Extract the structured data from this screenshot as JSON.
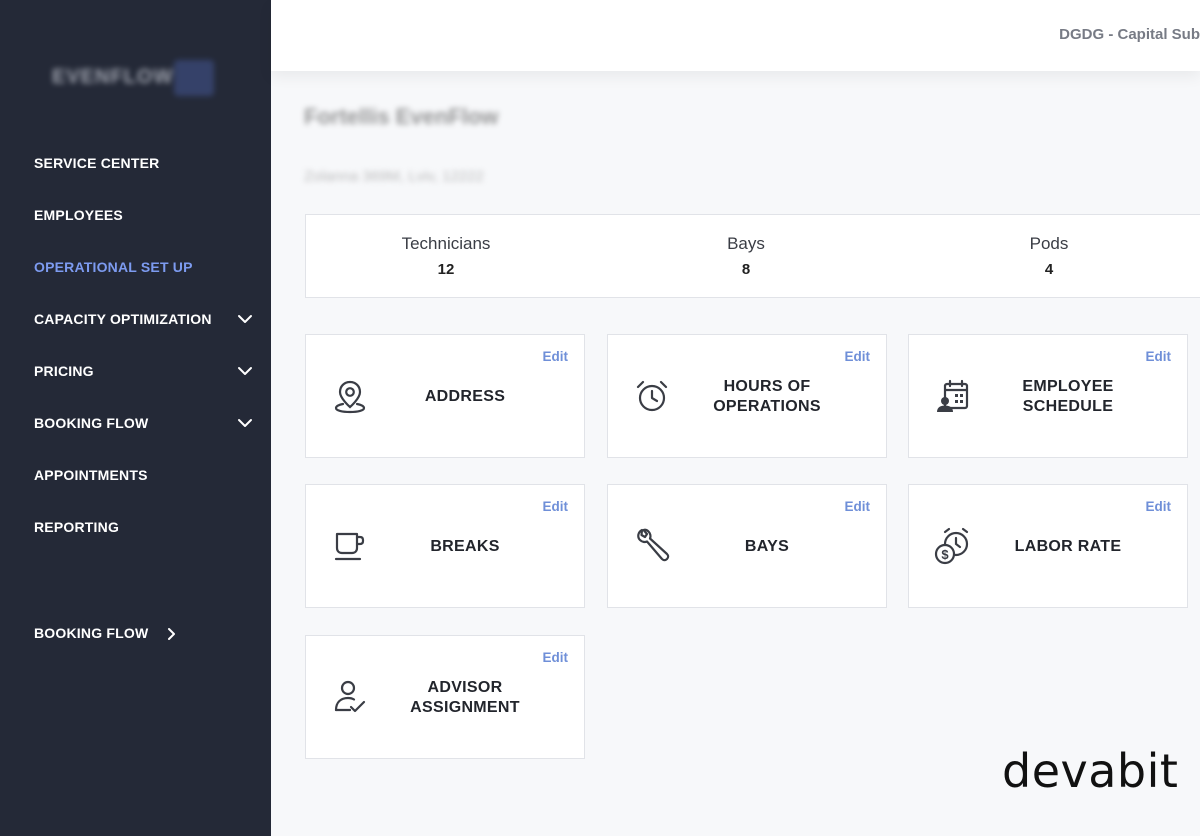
{
  "sidebar": {
    "logo_text": "EVENFLOW",
    "items": [
      {
        "label": "SERVICE CENTER"
      },
      {
        "label": "EMPLOYEES"
      },
      {
        "label": "OPERATIONAL SET UP"
      },
      {
        "label": "CAPACITY OPTIMIZATION"
      },
      {
        "label": "PRICING"
      },
      {
        "label": "BOOKING FLOW"
      },
      {
        "label": "APPOINTMENTS"
      },
      {
        "label": "REPORTING"
      }
    ],
    "bottom_item": {
      "label": "BOOKING FLOW"
    },
    "active_color": "#7d9bf0"
  },
  "header": {
    "account_name": "DGDG - Capital Sub"
  },
  "main": {
    "title": "Fortellis EvenFlow",
    "subtitle": "Zolanna 369M, Lviv, 12222",
    "stats": [
      {
        "label": "Technicians",
        "value": "12"
      },
      {
        "label": "Bays",
        "value": "8"
      },
      {
        "label": "Pods",
        "value": "4"
      }
    ],
    "edit_label": "Edit",
    "cards": [
      {
        "label": "ADDRESS",
        "icon": "location-pin-icon"
      },
      {
        "label": "HOURS OF\nOPERATIONS",
        "icon": "alarm-clock-icon"
      },
      {
        "label": "EMPLOYEE\nSCHEDULE",
        "icon": "calendar-person-icon"
      },
      {
        "label": "BREAKS",
        "icon": "coffee-cup-icon"
      },
      {
        "label": "BAYS",
        "icon": "wrench-icon"
      },
      {
        "label": "LABOR RATE",
        "icon": "clock-dollar-icon"
      },
      {
        "label": "ADVISOR\nASSIGNMENT",
        "icon": "person-check-icon"
      }
    ]
  },
  "watermark": "devabit"
}
